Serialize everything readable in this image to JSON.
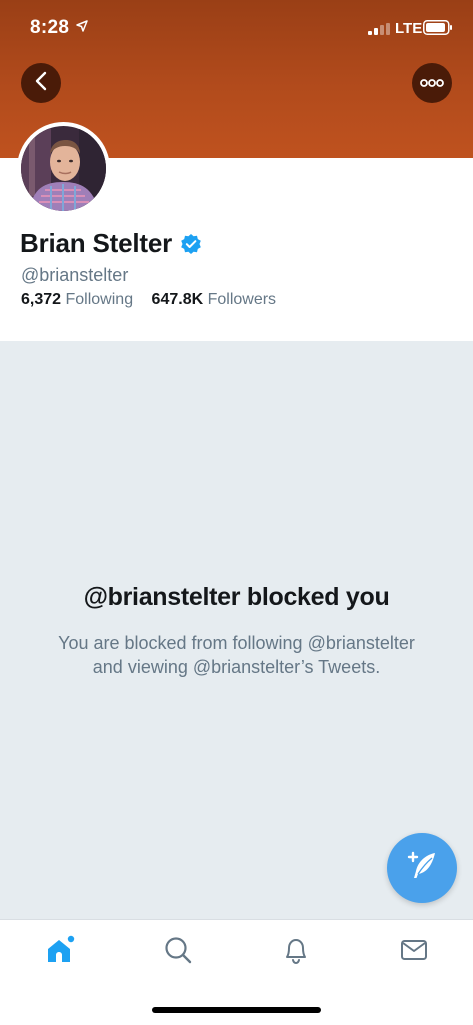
{
  "status_bar": {
    "time": "8:28",
    "network": "LTE",
    "signal_bars": 2,
    "battery_level": 0.8
  },
  "header": {
    "back_icon": "chevron-left-icon",
    "more_icon": "more-horizontal-icon",
    "banner_color": "#bf521f"
  },
  "profile": {
    "name": "Brian Stelter",
    "verified": true,
    "handle": "@brianstelter",
    "following_count": "6,372",
    "following_label": "Following",
    "followers_count": "647.8K",
    "followers_label": "Followers"
  },
  "blocked": {
    "title": "@brianstelter blocked you",
    "line1": "You are blocked from following @brianstelter",
    "line2": "and viewing @brianstelter’s Tweets."
  },
  "fab": {
    "icon": "compose-tweet-icon",
    "color": "#4aa1eb"
  },
  "tabs": [
    {
      "name": "home",
      "icon": "home-icon",
      "active": true
    },
    {
      "name": "search",
      "icon": "search-icon",
      "active": false
    },
    {
      "name": "notifications",
      "icon": "bell-icon",
      "active": false
    },
    {
      "name": "messages",
      "icon": "mail-icon",
      "active": false
    }
  ],
  "colors": {
    "accent": "#1da1f2",
    "secondary_text": "#657786",
    "blocked_bg": "#e6ecf0"
  }
}
